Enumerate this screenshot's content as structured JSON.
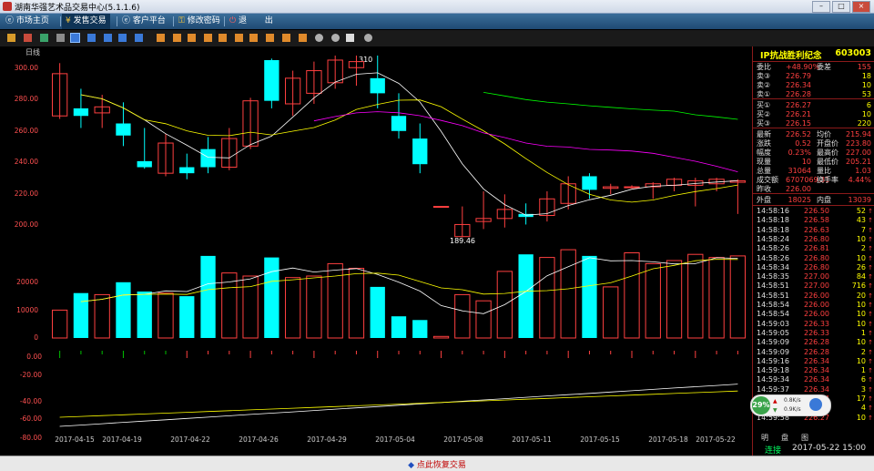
{
  "window": {
    "title": "湖南华强艺术品交易中心(5.1.1.6)"
  },
  "menu": {
    "items": [
      {
        "label": "市场主页",
        "icon": "e-icon"
      },
      {
        "label": "发售交易",
        "icon": "coin-icon",
        "active": true
      },
      {
        "label": "客户平台",
        "icon": "e-icon"
      },
      {
        "label": "修改密码",
        "icon": "key-icon"
      },
      {
        "label": "退",
        "icon": "power-icon"
      },
      {
        "label": "出",
        "icon": ""
      }
    ]
  },
  "chart": {
    "period_label": "日线",
    "high_label": "310",
    "low_label": "189.46",
    "price_ticks": [
      "300.00",
      "280.00",
      "260.00",
      "240.00",
      "220.00",
      "200.00"
    ],
    "volume_ticks": [
      "20000",
      "10000",
      "0"
    ],
    "indicator_ticks": [
      "0.00",
      "-20.00",
      "-40.00",
      "-60.00",
      "-80.00"
    ],
    "dates": [
      "2017-04-15",
      "2017-04-19",
      "2017-04-22",
      "2017-04-26",
      "2017-04-29",
      "2017-05-04",
      "2017-05-08",
      "2017-05-11",
      "2017-05-15",
      "2017-05-18",
      "2017-05-22"
    ]
  },
  "chart_data": {
    "type": "candlestick",
    "ylim": [
      188,
      310
    ],
    "volume_ylim": [
      0,
      30000
    ],
    "candles": [
      {
        "o": 270,
        "c": 298,
        "h": 305,
        "l": 268,
        "v": 9000
      },
      {
        "o": 275,
        "c": 270,
        "h": 288,
        "l": 262,
        "v": 14500
      },
      {
        "o": 272,
        "c": 276,
        "h": 284,
        "l": 262,
        "v": 14000
      },
      {
        "o": 265,
        "c": 257,
        "h": 279,
        "l": 250,
        "v": 18000
      },
      {
        "o": 240,
        "c": 236,
        "h": 262,
        "l": 235,
        "v": 15000
      },
      {
        "o": 232,
        "c": 252,
        "h": 258,
        "l": 230,
        "v": 14500
      },
      {
        "o": 236,
        "c": 232,
        "h": 245,
        "l": 228,
        "v": 13500
      },
      {
        "o": 248,
        "c": 236,
        "h": 256,
        "l": 232,
        "v": 26500
      },
      {
        "o": 236,
        "c": 255,
        "h": 262,
        "l": 234,
        "v": 21000
      },
      {
        "o": 250,
        "c": 280,
        "h": 282,
        "l": 248,
        "v": 20000
      },
      {
        "o": 307,
        "c": 280,
        "h": 308,
        "l": 275,
        "v": 26000
      },
      {
        "o": 278,
        "c": 295,
        "h": 300,
        "l": 270,
        "v": 19500
      },
      {
        "o": 285,
        "c": 300,
        "h": 306,
        "l": 278,
        "v": 20000
      },
      {
        "o": 292,
        "c": 307,
        "h": 310,
        "l": 288,
        "v": 24000
      },
      {
        "o": 302,
        "c": 306,
        "h": 310,
        "l": 290,
        "v": 22500
      },
      {
        "o": 295,
        "c": 285,
        "h": 310,
        "l": 275,
        "v": 16500
      },
      {
        "o": 270,
        "c": 260,
        "h": 285,
        "l": 255,
        "v": 7000
      },
      {
        "o": 255,
        "c": 238,
        "h": 265,
        "l": 232,
        "v": 5800
      },
      {
        "o": 210,
        "c": 210,
        "h": 210,
        "l": 210,
        "v": 500
      },
      {
        "o": 190,
        "c": 198,
        "h": 210,
        "l": 189.46,
        "v": 14000
      },
      {
        "o": 200,
        "c": 202,
        "h": 220,
        "l": 195,
        "v": 12000
      },
      {
        "o": 202,
        "c": 208,
        "h": 218,
        "l": 196,
        "v": 21500
      },
      {
        "o": 205,
        "c": 203,
        "h": 212,
        "l": 198,
        "v": 27000
      },
      {
        "o": 204,
        "c": 215,
        "h": 220,
        "l": 200,
        "v": 26000
      },
      {
        "o": 212,
        "c": 225,
        "h": 230,
        "l": 208,
        "v": 28500
      },
      {
        "o": 230,
        "c": 221,
        "h": 232,
        "l": 215,
        "v": 26500
      },
      {
        "o": 222,
        "c": 223,
        "h": 225,
        "l": 218,
        "v": 16500
      },
      {
        "o": 223,
        "c": 223,
        "h": 224,
        "l": 222,
        "v": 27500
      },
      {
        "o": 223,
        "c": 225,
        "h": 226,
        "l": 215,
        "v": 24000
      },
      {
        "o": 224,
        "c": 228,
        "h": 229,
        "l": 220,
        "v": 25000
      },
      {
        "o": 224,
        "c": 227,
        "h": 229,
        "l": 210,
        "v": 27000
      },
      {
        "o": 225,
        "c": 228,
        "h": 229,
        "l": 220,
        "v": 26000
      },
      {
        "o": 226,
        "c": 227,
        "h": 228,
        "l": 205,
        "v": 26500
      }
    ]
  },
  "quote": {
    "name": "IP抗战胜利纪念",
    "code": "603003",
    "rows": [
      {
        "label": "委比",
        "v1": "+48.90%",
        "l2": "委差",
        "v2": "155"
      },
      {
        "label": "卖③",
        "v1": "226.79",
        "v2": "18"
      },
      {
        "label": "卖②",
        "v1": "226.34",
        "v2": "10"
      },
      {
        "label": "卖①",
        "v1": "226.28",
        "v2": "53"
      },
      {
        "label": "买①",
        "v1": "226.27",
        "v2": "6"
      },
      {
        "label": "买②",
        "v1": "226.21",
        "v2": "10"
      },
      {
        "label": "买③",
        "v1": "226.15",
        "v2": "220"
      },
      {
        "label": "最新",
        "v1": "226.52",
        "l2": "均价",
        "v2": "215.94"
      },
      {
        "label": "涨跌",
        "v1": "0.52",
        "l2": "开盘价",
        "v2": "223.80"
      },
      {
        "label": "幅度",
        "v1": "0.23%",
        "l2": "最高价",
        "v2": "227.00"
      },
      {
        "label": "现量",
        "v1": "10",
        "l2": "最低价",
        "v2": "205.21"
      },
      {
        "label": "总量",
        "v1": "31064",
        "l2": "量比",
        "v2": "1.03"
      },
      {
        "label": "成交额",
        "v1": "6707069.31",
        "l2": "换手率",
        "v2": "4.44%"
      },
      {
        "label": "昨收",
        "v1": "226.00",
        "l2": "",
        "v2": ""
      },
      {
        "label": "外盘",
        "v1": "18025",
        "l2": "内盘",
        "v2": "13039"
      }
    ],
    "ticks": [
      {
        "t": "14:58:16",
        "p": "226.50",
        "q": "52"
      },
      {
        "t": "14:58:18",
        "p": "226.58",
        "q": "43"
      },
      {
        "t": "14:58:18",
        "p": "226.63",
        "q": "7"
      },
      {
        "t": "14:58:24",
        "p": "226.80",
        "q": "10"
      },
      {
        "t": "14:58:26",
        "p": "226.81",
        "q": "2"
      },
      {
        "t": "14:58:26",
        "p": "226.80",
        "q": "10"
      },
      {
        "t": "14:58:34",
        "p": "226.80",
        "q": "26"
      },
      {
        "t": "14:58:35",
        "p": "227.00",
        "q": "84"
      },
      {
        "t": "14:58:51",
        "p": "227.00",
        "q": "716"
      },
      {
        "t": "14:58:51",
        "p": "226.00",
        "q": "20"
      },
      {
        "t": "14:58:54",
        "p": "226.00",
        "q": "10"
      },
      {
        "t": "14:58:54",
        "p": "226.00",
        "q": "10"
      },
      {
        "t": "14:59:03",
        "p": "226.33",
        "q": "10"
      },
      {
        "t": "14:59:05",
        "p": "226.33",
        "q": "1"
      },
      {
        "t": "14:59:09",
        "p": "226.28",
        "q": "10"
      },
      {
        "t": "14:59:09",
        "p": "226.28",
        "q": "2"
      },
      {
        "t": "14:59:16",
        "p": "226.34",
        "q": "10"
      },
      {
        "t": "14:59:18",
        "p": "226.34",
        "q": "1"
      },
      {
        "t": "14:59:34",
        "p": "226.34",
        "q": "6"
      },
      {
        "t": "14:59:37",
        "p": "226.34",
        "q": "3"
      },
      {
        "t": "14:59:42",
        "p": "226.34",
        "q": "17"
      },
      {
        "t": "14:59:53",
        "p": "226.29",
        "q": "4"
      },
      {
        "t": "14:59:58",
        "p": "226.27",
        "q": "10"
      }
    ],
    "tabs": [
      "明",
      "盘",
      "图"
    ]
  },
  "status": {
    "connection": "连接",
    "datetime": "2017-05-22 15:00",
    "restore_label": "点此恢复交易"
  },
  "widget": {
    "percent": "29%",
    "up": "0.8K/s",
    "down": "0.9K/s"
  },
  "colors": {
    "up": "#ff4040",
    "down": "#00ffff",
    "accent": "#ffff00",
    "ma5": "#ffffff",
    "ma10": "#ffff00",
    "ma20": "#ff00ff",
    "ma60": "#00ff00"
  }
}
